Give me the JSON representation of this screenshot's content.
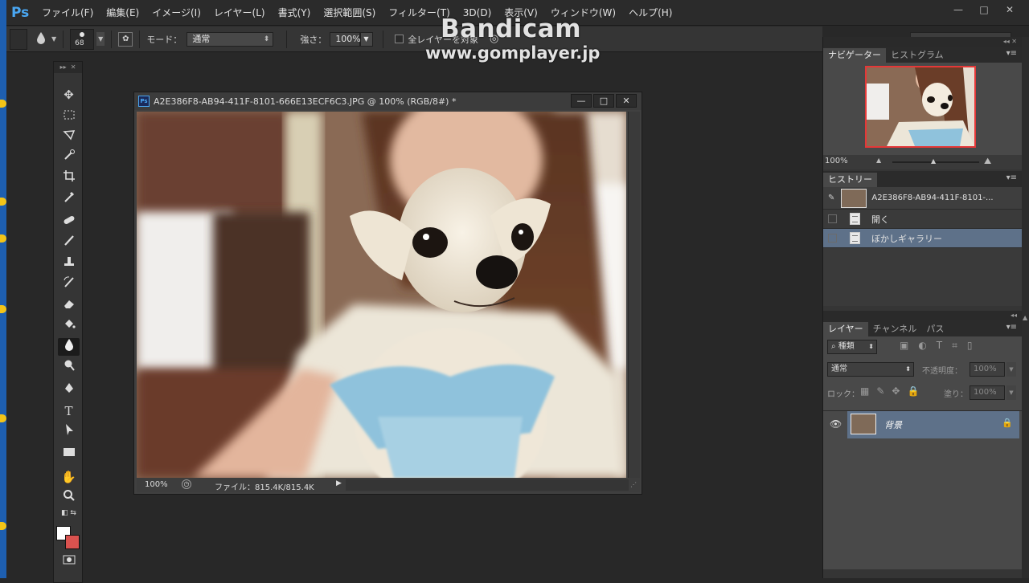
{
  "app": {
    "logo": "Ps"
  },
  "menu": [
    "ファイル(F)",
    "編集(E)",
    "イメージ(I)",
    "レイヤー(L)",
    "書式(Y)",
    "選択範囲(S)",
    "フィルター(T)",
    "3D(D)",
    "表示(V)",
    "ウィンドウ(W)",
    "ヘルプ(H)"
  ],
  "window_controls": {
    "minimize": "—",
    "maximize": "□",
    "close": "✕"
  },
  "options": {
    "brush_size": "68",
    "mode_label": "モード：",
    "mode_value": "通常",
    "strength_label": "強さ：",
    "strength_value": "100%",
    "all_layers_label": "全レイヤーを対象"
  },
  "watermark": {
    "line1": "Bandicam",
    "line2": "www.gomplayer.jp"
  },
  "document": {
    "title": "A2E386F8-AB94-411F-8101-666E13ECF6C3.JPG @ 100% (RGB/8#) *",
    "zoom": "100%",
    "file_info": "ファイル：815.4K/815.4K"
  },
  "navigator": {
    "tabs": [
      "ナビゲーター",
      "ヒストグラム"
    ],
    "zoom": "100%"
  },
  "history": {
    "tab": "ヒストリー",
    "snapshot": "A2E386F8-AB94-411F-8101-...",
    "items": [
      "開く",
      "ぼかしギャラリー"
    ],
    "selected_index": 1
  },
  "layers": {
    "tabs": [
      "レイヤー",
      "チャンネル",
      "パス"
    ],
    "filter_kind": "種類",
    "blend_mode": "通常",
    "opacity_label": "不透明度：",
    "opacity_value": "100%",
    "lock_label": "ロック：",
    "fill_label": "塗り：",
    "fill_value": "100%",
    "layer_name": "背景"
  },
  "colors": {
    "accent": "#4aa7f2",
    "selection": "#5e7189",
    "foreground": "#ffffff",
    "background": "#d9524f"
  }
}
